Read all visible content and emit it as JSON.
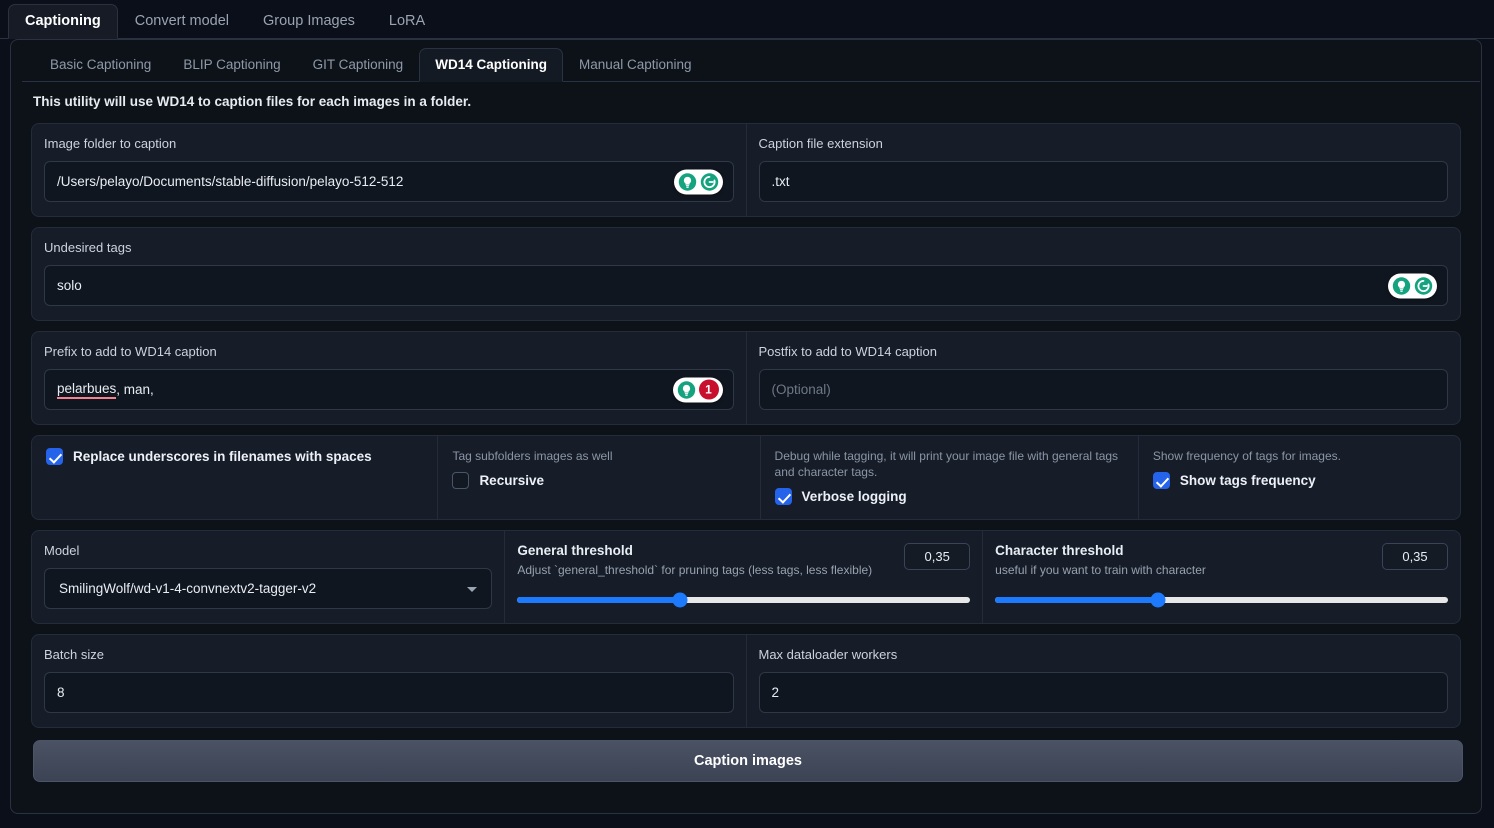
{
  "top_tabs": [
    {
      "label": "Captioning",
      "active": true
    },
    {
      "label": "Convert model",
      "active": false
    },
    {
      "label": "Group Images",
      "active": false
    },
    {
      "label": "LoRA",
      "active": false
    }
  ],
  "sub_tabs": [
    {
      "label": "Basic Captioning",
      "active": false
    },
    {
      "label": "BLIP Captioning",
      "active": false
    },
    {
      "label": "GIT Captioning",
      "active": false
    },
    {
      "label": "WD14 Captioning",
      "active": true
    },
    {
      "label": "Manual Captioning",
      "active": false
    }
  ],
  "utility_note": "This utility will use WD14 to caption files for each images in a folder.",
  "fields": {
    "image_folder": {
      "label": "Image folder to caption",
      "value": "/Users/pelayo/Documents/stable-diffusion/pelayo-512-512",
      "placeholder": ""
    },
    "caption_extension": {
      "label": "Caption file extension",
      "value": ".txt",
      "placeholder": ""
    },
    "undesired_tags": {
      "label": "Undesired tags",
      "value": "solo",
      "placeholder": ""
    },
    "prefix": {
      "label": "Prefix to add to WD14 caption",
      "value_misspelled": "pelarbues",
      "value_rest": ", man,",
      "badge_count": "1"
    },
    "postfix": {
      "label": "Postfix to add to WD14 caption",
      "value": "",
      "placeholder": "(Optional)"
    },
    "batch_size": {
      "label": "Batch size",
      "value": "8"
    },
    "max_dataloader_workers": {
      "label": "Max dataloader workers",
      "value": "2"
    }
  },
  "checkboxes": {
    "replace_underscores": {
      "label": "Replace underscores in filenames with spaces",
      "hint": "",
      "checked": true
    },
    "recursive": {
      "label": "Recursive",
      "hint": "Tag subfolders images as well",
      "checked": false
    },
    "verbose_logging": {
      "label": "Verbose logging",
      "hint": "Debug while tagging, it will print your image file with general tags and character tags.",
      "checked": true
    },
    "show_tags_frequency": {
      "label": "Show tags frequency",
      "hint": "Show frequency of tags for images.",
      "checked": true
    }
  },
  "model": {
    "label": "Model",
    "value": "SmilingWolf/wd-v1-4-convnextv2-tagger-v2"
  },
  "sliders": {
    "general_threshold": {
      "title": "General threshold",
      "subtitle": "Adjust `general_threshold` for pruning tags (less tags, less flexible)",
      "value": "0,35",
      "percent": 36
    },
    "character_threshold": {
      "title": "Character threshold",
      "subtitle": "useful if you want to train with character",
      "value": "0,35",
      "percent": 36
    }
  },
  "action_button": {
    "label": "Caption images"
  },
  "colors": {
    "accent_blue": "#2563eb",
    "slider_blue": "#1d7afc",
    "grammarly_green": "#15a37f",
    "badge_red": "#c8102e",
    "spell_underline": "#f2838f",
    "panel_bg": "#161d28",
    "page_bg": "#0b0f19"
  }
}
